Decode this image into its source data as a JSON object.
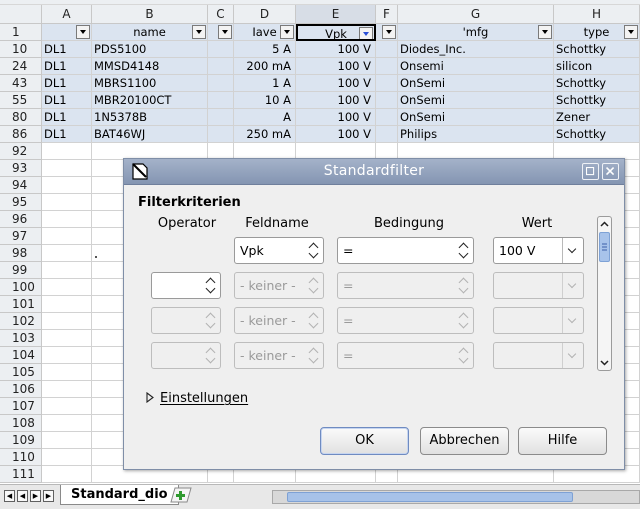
{
  "columns": [
    {
      "letter": "A",
      "filter": false,
      "selected": false
    },
    {
      "letter": "B"
    },
    {
      "letter": "C"
    },
    {
      "letter": "D"
    },
    {
      "letter": "E",
      "selected": true
    },
    {
      "letter": "F"
    },
    {
      "letter": "G"
    },
    {
      "letter": "H"
    }
  ],
  "header_row": {
    "num": "1",
    "cells": [
      "",
      "name",
      "",
      "Iave",
      "Vpk",
      "",
      "'mfg",
      "type"
    ]
  },
  "rows": [
    {
      "num": "10",
      "cells": [
        "DL1",
        "PDS5100",
        "",
        "5 A",
        "100 V",
        "",
        "Diodes_Inc.",
        "Schottky"
      ]
    },
    {
      "num": "24",
      "cells": [
        "DL1",
        "MMSD4148",
        "",
        "200 mA",
        "100 V",
        "",
        "Onsemi",
        "silicon"
      ]
    },
    {
      "num": "43",
      "cells": [
        "DL1",
        "MBRS1100",
        "",
        "1 A",
        "100 V",
        "",
        "OnSemi",
        "Schottky"
      ]
    },
    {
      "num": "55",
      "cells": [
        "DL1",
        "MBR20100CT",
        "",
        "10 A",
        "100 V",
        "",
        "OnSemi",
        "Schottky"
      ]
    },
    {
      "num": "80",
      "cells": [
        "DL1",
        "1N5378B",
        "",
        "A",
        "100 V",
        "",
        "OnSemi",
        "Zener"
      ]
    },
    {
      "num": "86",
      "cells": [
        "DL1",
        "BAT46WJ",
        "",
        "250 mA",
        "100 V",
        "",
        "Philips",
        "Schottky"
      ]
    }
  ],
  "empty_rows": [
    "92",
    "93",
    "94",
    "95",
    "96",
    "97",
    "98",
    "99",
    "100",
    "101",
    "102",
    "103",
    "104",
    "105",
    "106",
    "107",
    "108",
    "109",
    "110",
    "111"
  ],
  "sheet": {
    "tab_label": "Standard_dio"
  },
  "dialog": {
    "title": "Standardfilter",
    "section": "Filterkriterien",
    "headers": {
      "operator": "Operator",
      "field": "Feldname",
      "condition": "Bedingung",
      "value": "Wert"
    },
    "rows": [
      {
        "operator": "",
        "field": "Vpk",
        "condition": "=",
        "value": "100 V",
        "enabled": true
      },
      {
        "operator": "",
        "field": "- keiner -",
        "condition": "=",
        "value": "",
        "enabled": false
      },
      {
        "operator": "",
        "field": "- keiner -",
        "condition": "=",
        "value": "",
        "enabled": false
      },
      {
        "operator": "",
        "field": "- keiner -",
        "condition": "=",
        "value": "",
        "enabled": false
      }
    ],
    "expander_label": "Einstellungen",
    "buttons": {
      "ok": "OK",
      "cancel": "Abbrechen",
      "help": "Hilfe"
    }
  },
  "colors": {
    "highlight": "#dbe4f0",
    "titlebar": "#8a9bb8",
    "header_bg": "#eceff2"
  }
}
